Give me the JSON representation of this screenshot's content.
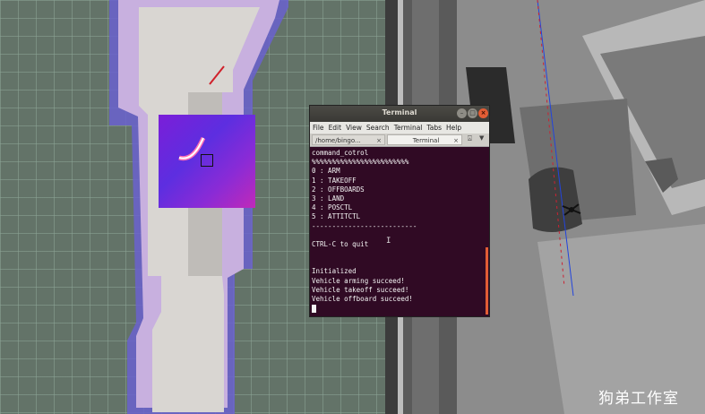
{
  "terminal": {
    "title": "Terminal",
    "menu": [
      "File",
      "Edit",
      "View",
      "Search",
      "Terminal",
      "Tabs",
      "Help"
    ],
    "tabs": [
      {
        "label": "/home/bingo..."
      },
      {
        "label": "Terminal"
      }
    ],
    "lines": [
      "command_cotrol",
      "%%%%%%%%%%%%%%%%%%%%%%%%",
      "0 : ARM",
      "1 : TAKEOFF",
      "2 : OFFBOARDS",
      "3 : LAND",
      "4 : POSCTL",
      "5 : ATTITCTL",
      "--------------------------",
      "",
      "CTRL-C to quit",
      "",
      "",
      "Initialized",
      "Vehicle arming succeed!",
      "Vehicle takeoff succeed!",
      "Vehicle offboard succeed!"
    ],
    "colors": {
      "background": "#300a24",
      "text": "#f4f4f4",
      "accent": "#e25d35"
    }
  },
  "watermark": "狗弟工作室",
  "icons": {
    "minimize": "minimize-icon",
    "maximize": "maximize-icon",
    "close": "close-icon",
    "new_tab": "new-tab-icon",
    "tab_menu": "chevron-down-icon"
  }
}
